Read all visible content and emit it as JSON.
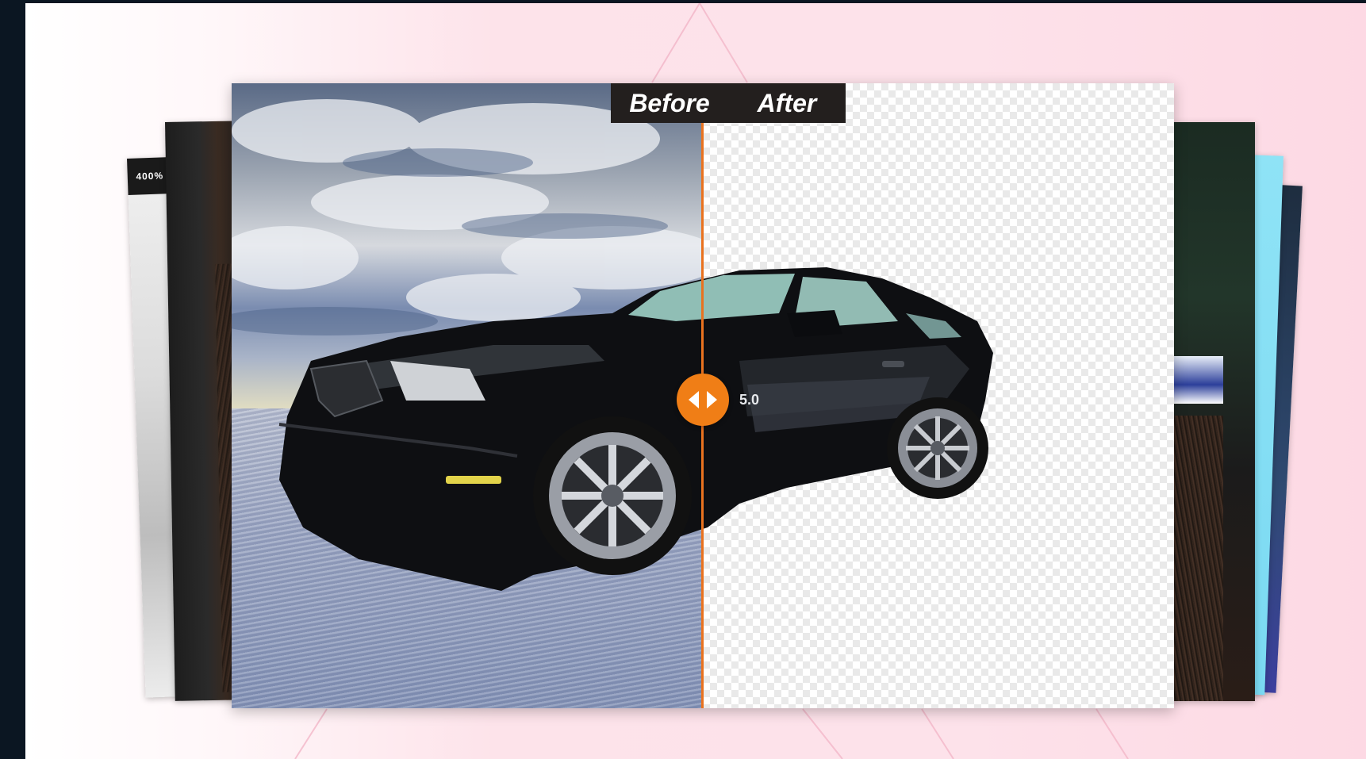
{
  "viewer": {
    "before_label": "Before",
    "after_label": "After",
    "handle_icon": "left-right-arrows-icon",
    "accent_color": "#f07e16",
    "divider_color": "#e9721f"
  },
  "car": {
    "badge": "5.0"
  },
  "side_cards": {
    "zoom_badge": "400%"
  }
}
